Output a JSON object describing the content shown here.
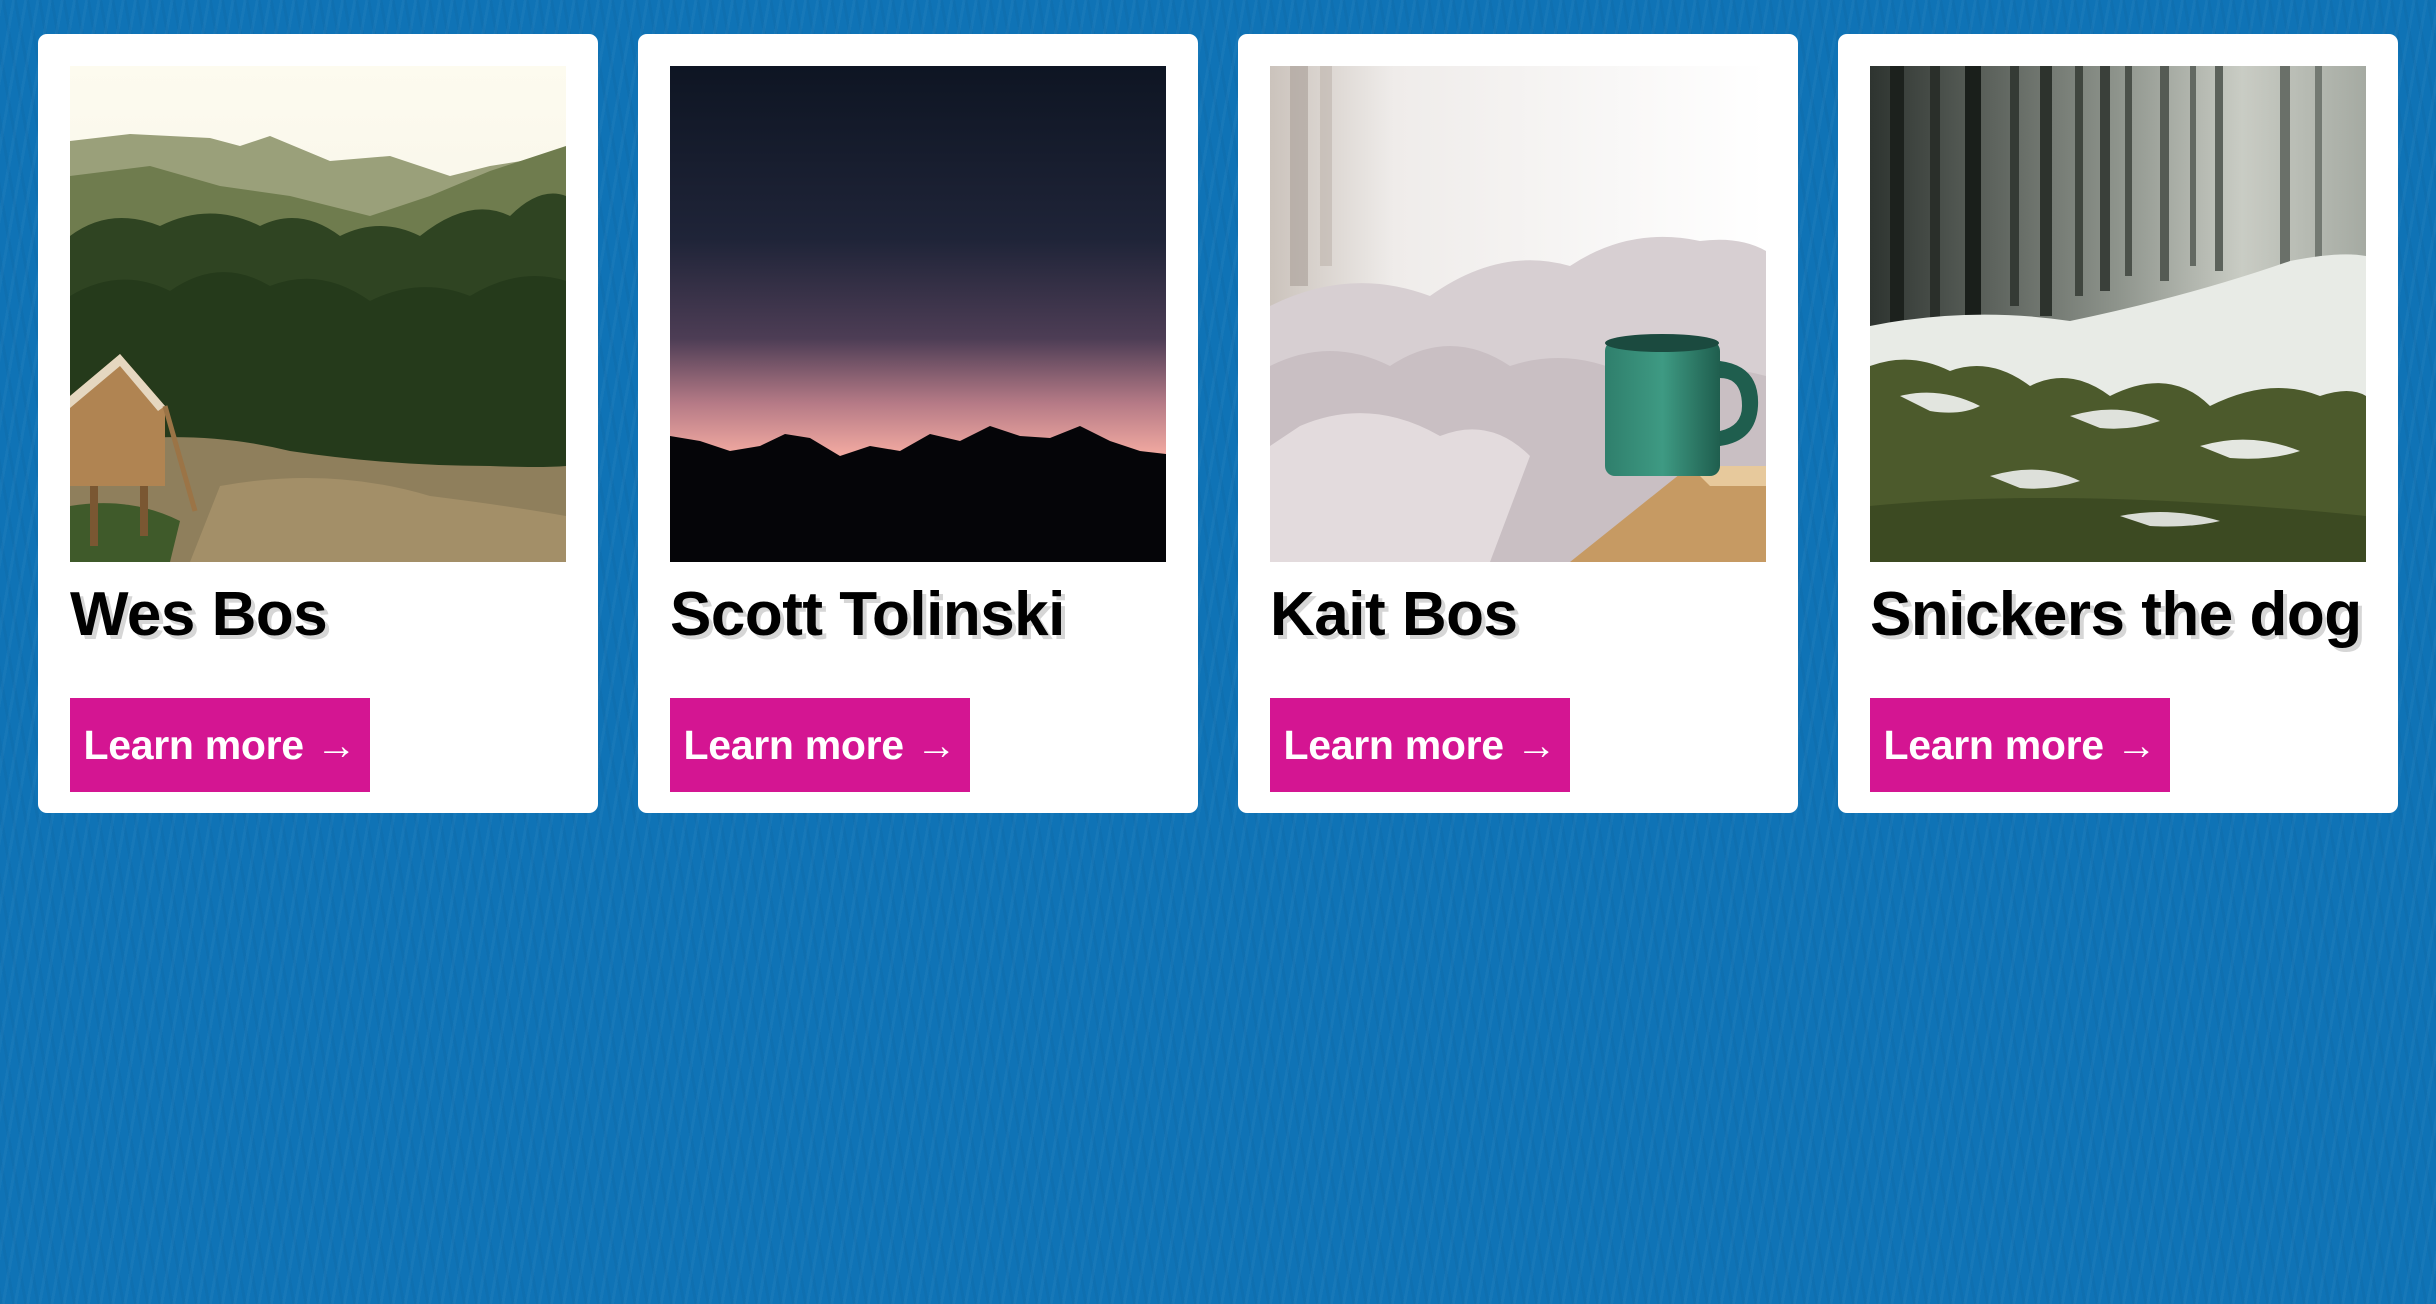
{
  "cards": [
    {
      "name": "Wes Bos",
      "button_label": "Learn more",
      "icon": "arrow-right-icon",
      "arrow": "→"
    },
    {
      "name": "Scott Tolinski",
      "button_label": "Learn more",
      "icon": "arrow-right-icon",
      "arrow": "→"
    },
    {
      "name": "Kait Bos",
      "button_label": "Learn more",
      "icon": "arrow-right-icon",
      "arrow": "→"
    },
    {
      "name": "Snickers the dog",
      "button_label": "Learn more",
      "icon": "arrow-right-icon",
      "arrow": "→"
    }
  ],
  "colors": {
    "background": "#0f73b6",
    "card": "#ffffff",
    "button": "#d41592",
    "button_text": "#ffffff",
    "name_text": "#000000"
  }
}
